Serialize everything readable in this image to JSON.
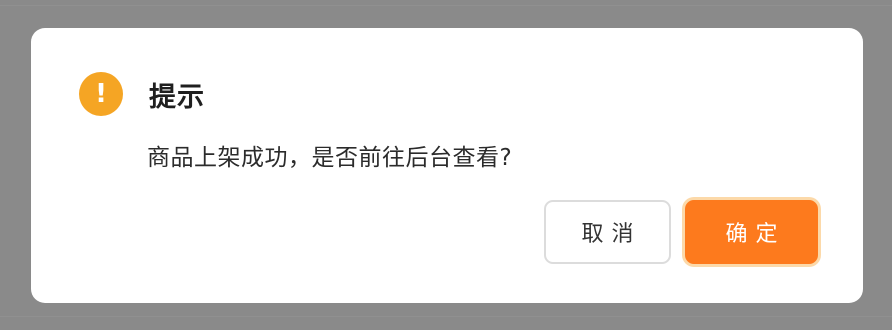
{
  "dialog": {
    "title": "提示",
    "icon": "warning-icon",
    "icon_glyph": "!",
    "message": "商品上架成功，是否前往后台查看?",
    "cancel_label": "取消",
    "confirm_label": "确定"
  },
  "colors": {
    "accent": "#fd7a1d",
    "warning": "#f5a524",
    "overlay": "#8a8a8a"
  }
}
